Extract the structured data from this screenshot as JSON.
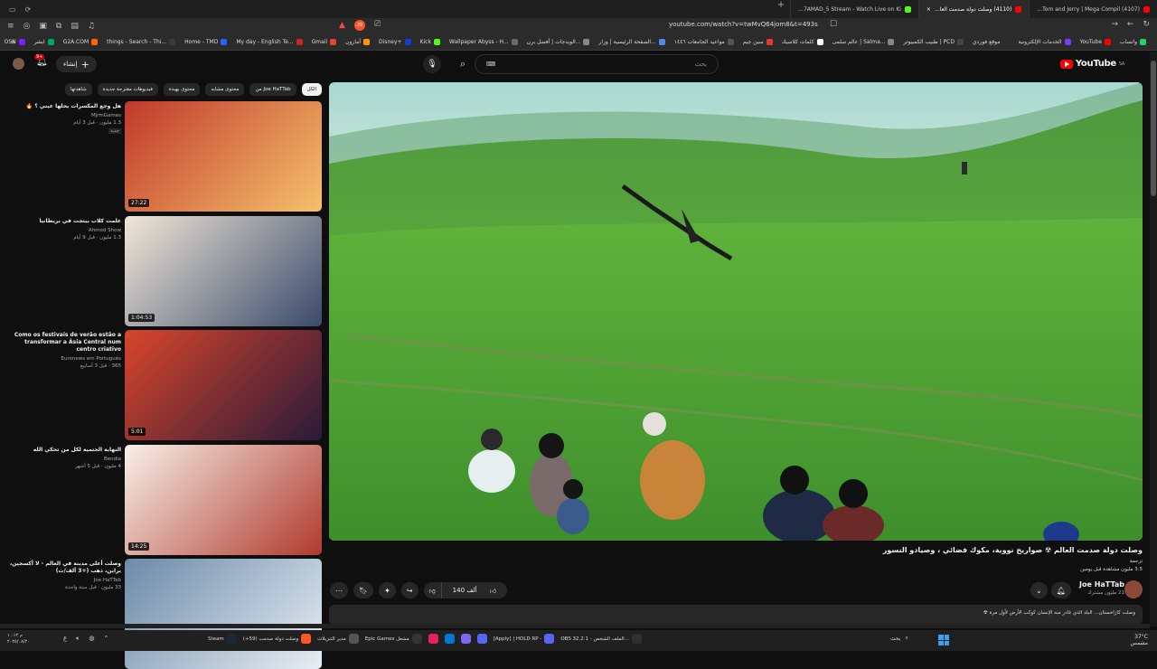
{
  "browser": {
    "tabs": [
      {
        "label": "(4107) Tom and Jerry | Mega Compil...",
        "color": "#ff0000",
        "active": false
      },
      {
        "label": "(4110) وصلت دولة صدمت العا...",
        "color": "#ff0000",
        "active": true
      },
      {
        "label": "7AMAD_5 Stream - Watch Live on Ki...",
        "color": "#53fc18",
        "active": false
      }
    ],
    "new_tab": "+",
    "address": "youtube.com/watch?v=twMvQ64jom8&t=493s",
    "brave_badge": "29",
    "bookmarks": [
      "واتساب",
      "YouTube",
      "الخدمات الإلكترونية",
      "موقع فوردي",
      "طبيب الكمبيوتر | PCD",
      "عالم سلمى | Salma...",
      "كلمات كلاسيك",
      "سين جيم",
      "مواعيد الجامعات ١٤٤٦",
      "الصفحة الرئيسية | وزار...",
      "الويدجات | أفضل برن...",
      "Wallpaper Abyss - H...",
      "Kick",
      "Disney+",
      "أمازون",
      "Gmail",
      "My day - English Te...",
      "Home - TMD",
      "things - Search - Thi...",
      "G2A.COM",
      "ابشر",
      "OSN"
    ],
    "bookmark_colors": [
      "#25d366",
      "#ff0000",
      "#7a3aff",
      "#2b2b2b",
      "#444",
      "#888",
      "#fff",
      "#e53935",
      "#555",
      "#4c8bf5",
      "#888",
      "#6a6a6a",
      "#53fc18",
      "#113ccf",
      "#ff9900",
      "#ea4335",
      "#c62828",
      "#2962ff",
      "#3a3a3a",
      "#ff6600",
      "#00a862",
      "#7a1fff"
    ]
  },
  "youtube": {
    "logo_text": "YouTube",
    "logo_region": "SA",
    "search_placeholder": "بحث",
    "create_label": "إنشاء",
    "notif_count": "9+",
    "chips": [
      "الكل",
      "من Joe HaTTab",
      "محتوى مشابه",
      "محتوى بهبدة",
      "فيديوهات مقترحة جديدة",
      "شاهدتها"
    ]
  },
  "related": [
    {
      "title": "هل وجع المكسرات يحلها عيني ؟ 🔥",
      "channel": "MjrmGames",
      "views": "1.3 مليون · قبل 3 أيام",
      "badge": "جديد",
      "duration": "27:22"
    },
    {
      "title": "علمت كلاب بيتجت في بريطانيا",
      "channel": "Ahmed Show",
      "views": "1.3 مليون · قبل 9 أيام",
      "badge": "",
      "duration": "1:04:53"
    },
    {
      "title": "Como os festivais de verão estão a transformar a Ásia Central num centro criativo",
      "channel": "Euronews em Português",
      "views": "365 · قبل 3 أسابيع",
      "badge": "",
      "duration": "5:01"
    },
    {
      "title": "النهاية الحتمية لكل من تحكي الله",
      "channel": "Bendia",
      "views": "4 مليون · قبل 5 أشهر",
      "badge": "",
      "duration": "14:25"
    },
    {
      "title": "وصلت أعلى مدينة في العالم - لا أكسجين، براين، ذهب (+3 ألف/ث)",
      "channel": "Joe HaTTab",
      "views": "33 مليون · قبل سنة واحدة",
      "badge": "",
      "duration": ""
    }
  ],
  "video": {
    "title": "وصلت دولة صدمت العالم ☢ صواريخ نووية، مكوك فضائي ، وصيادو النسور",
    "views_line": "ترجمة",
    "views_count": "3.5 مليون مشاهدة قبل يومين",
    "channel": "Joe HaTTab",
    "subs": "21 مليون مشترك",
    "likes": "140 ألف",
    "description": "وصلت كازاخستان... البلد الذي غادر منه الإنسان كوكب الأرض لأول مرة ☢"
  },
  "taskbar": {
    "apps": [
      {
        "label": "OBS 32.2.1 - الملف الشخص...",
        "color": "#303030"
      },
      {
        "label": "[Apply] | HOLD RP -",
        "color": "#5865f2"
      },
      {
        "label": "",
        "color": "#5865f2"
      },
      {
        "label": "",
        "color": "#7b68ee"
      },
      {
        "label": "",
        "color": "#0078d4"
      },
      {
        "label": "",
        "color": "#e91e63"
      },
      {
        "label": "Epic Games مشغل",
        "color": "#333"
      },
      {
        "label": "مدير التنزيلات",
        "color": "#555"
      },
      {
        "label": "وصلت دولة صدمت (59+)",
        "color": "#ff5722"
      },
      {
        "label": "Steam",
        "color": "#1b2838"
      }
    ],
    "search_label": "بحث",
    "temp": "37°C",
    "weather": "مشمس",
    "time": "م ١٠:١٢",
    "date": "٢٠٢٥/٠٨/٢٠",
    "lang": "ع"
  }
}
